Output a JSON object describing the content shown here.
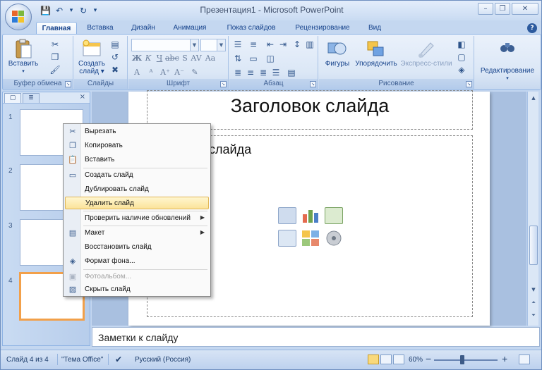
{
  "window": {
    "title": "Презентация1 - Microsoft PowerPoint",
    "controls": [
      "–",
      "❐",
      "✕"
    ]
  },
  "qat": {
    "save": "💾",
    "undo": "↶",
    "dropdown": "▾",
    "redo": "↻",
    "customize": "▾"
  },
  "ribbon": {
    "tabs": [
      "Главная",
      "Вставка",
      "Дизайн",
      "Анимация",
      "Показ слайдов",
      "Рецензирование",
      "Вид"
    ],
    "active_tab": "Главная",
    "groups": {
      "clipboard": {
        "label": "Буфер обмена",
        "paste": "Вставить"
      },
      "slides": {
        "label": "Слайды",
        "new_slide_line1": "Создать",
        "new_slide_line2": "слайд ▾"
      },
      "font": {
        "label": "Шрифт"
      },
      "paragraph": {
        "label": "Абзац"
      },
      "drawing": {
        "label": "Рисование",
        "shapes": "Фигуры",
        "arrange": "Упорядочить",
        "styles": "Экспресс-стили"
      },
      "editing": {
        "label": "Редактирование",
        "icon": "🔭"
      }
    }
  },
  "thumbnails": [
    {
      "number": "1",
      "selected": false
    },
    {
      "number": "2",
      "selected": false
    },
    {
      "number": "3",
      "selected": false
    },
    {
      "number": "4",
      "selected": true
    }
  ],
  "slide": {
    "title": "Заголовок слайда",
    "body_text": "слайда"
  },
  "notes": {
    "placeholder": "Заметки к слайду"
  },
  "context_menu": {
    "items": [
      {
        "label": "Вырезать",
        "icon": "scissors-icon",
        "highlighted": false,
        "disabled": false,
        "submenu": false
      },
      {
        "label": "Копировать",
        "icon": "copy-icon",
        "highlighted": false,
        "disabled": false,
        "submenu": false
      },
      {
        "label": "Вставить",
        "icon": "paste-icon",
        "highlighted": false,
        "disabled": false,
        "submenu": false
      },
      {
        "label": "Создать слайд",
        "icon": "new-slide-icon",
        "highlighted": false,
        "disabled": false,
        "submenu": false
      },
      {
        "label": "Дублировать слайд",
        "icon": "",
        "highlighted": false,
        "disabled": false,
        "submenu": false
      },
      {
        "label": "Удалить слайд",
        "icon": "",
        "highlighted": true,
        "disabled": false,
        "submenu": false
      },
      {
        "label": "Проверить наличие обновлений",
        "icon": "",
        "highlighted": false,
        "disabled": false,
        "submenu": true
      },
      {
        "label": "Макет",
        "icon": "layout-icon",
        "highlighted": false,
        "disabled": false,
        "submenu": true
      },
      {
        "label": "Восстановить слайд",
        "icon": "",
        "highlighted": false,
        "disabled": false,
        "submenu": false
      },
      {
        "label": "Формат фона...",
        "icon": "format-background-icon",
        "highlighted": false,
        "disabled": false,
        "submenu": false
      },
      {
        "label": "Фотоальбом...",
        "icon": "photo-album-icon",
        "highlighted": false,
        "disabled": true,
        "submenu": false
      },
      {
        "label": "Скрыть слайд",
        "icon": "hide-slide-icon",
        "highlighted": false,
        "disabled": false,
        "submenu": false
      }
    ]
  },
  "statusbar": {
    "slide_info": "Слайд 4 из 4",
    "theme": "\"Тема Office\"",
    "language": "Русский (Россия)",
    "zoom": "60%",
    "zoom_minus": "−",
    "zoom_plus": "+"
  }
}
